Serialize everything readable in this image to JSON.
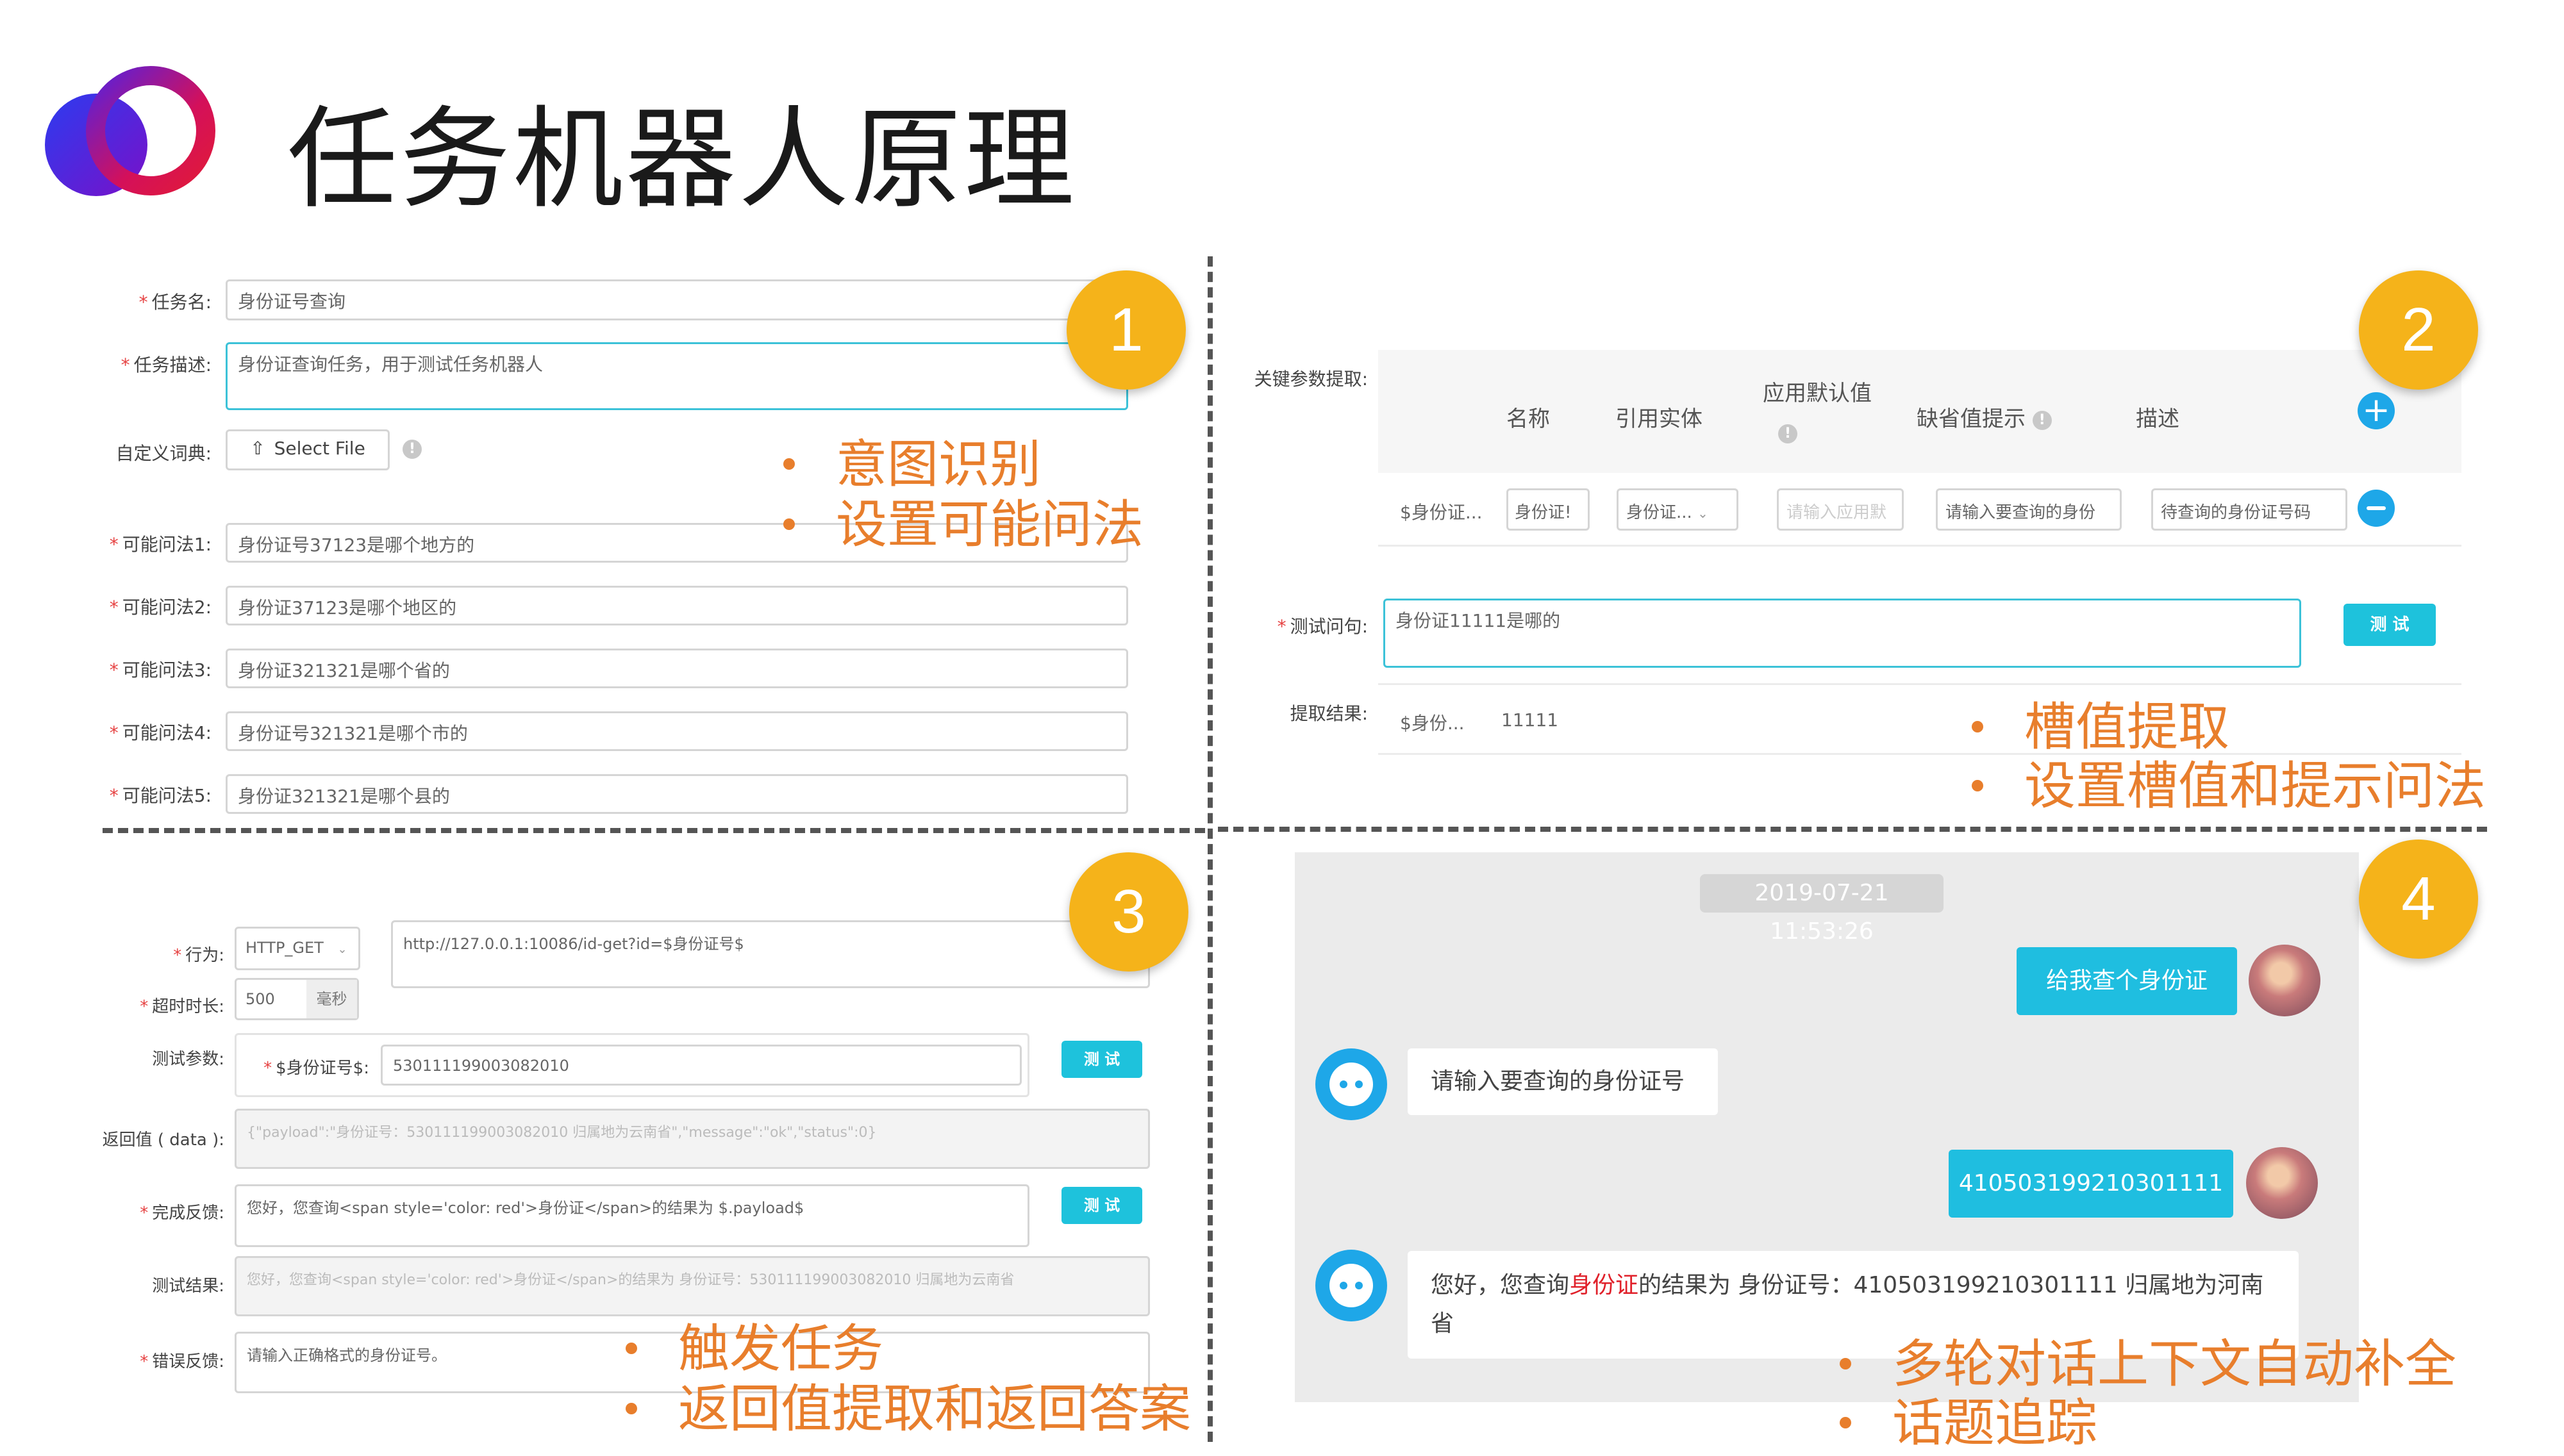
{
  "title": "任务机器人原理",
  "colors": {
    "accent": "#e87e2c",
    "badge": "#f5b31a",
    "button": "#1ec2dc",
    "chat_bubble": "#1fbee0"
  },
  "icons": {
    "logo": "overlapping-circles-logo",
    "upload": "upload-icon",
    "info": "info-icon",
    "add": "plus-circle-icon",
    "remove": "minus-circle-icon",
    "bot": "robot-avatar-icon",
    "user": "user-avatar-icon",
    "dropdown": "chevron-down-icon"
  },
  "panel1": {
    "badge": "1",
    "task_name_label": "任务名:",
    "task_name_value": "身份证号查询",
    "task_desc_label": "任务描述:",
    "task_desc_value": "身份证查询任务，用于测试任务机器人",
    "dict_label": "自定义词典:",
    "select_file": "Select File",
    "questions": [
      {
        "label": "可能问法1:",
        "value": "身份证号37123是哪个地方的"
      },
      {
        "label": "可能问法2:",
        "value": "身份证37123是哪个地区的"
      },
      {
        "label": "可能问法3:",
        "value": "身份证321321是哪个省的"
      },
      {
        "label": "可能问法4:",
        "value": "身份证号321321是哪个市的"
      },
      {
        "label": "可能问法5:",
        "value": "身份证321321是哪个县的"
      }
    ],
    "bullets": [
      "意图识别",
      "设置可能问法"
    ]
  },
  "panel2": {
    "badge": "2",
    "param_label": "关键参数提取:",
    "headers": {
      "name": "名称",
      "entity": "引用实体",
      "default": "应用默认值",
      "missing": "缺省值提示",
      "desc": "描述"
    },
    "row": {
      "name": "$身份证...",
      "entity_input": "身份证!",
      "entity_select": "身份证...",
      "default_placeholder": "请输入应用默",
      "missing": "请输入要查询的身份",
      "desc": "待查询的身份证号码"
    },
    "test_label": "测试问句:",
    "test_value": "身份证11111是哪的",
    "test_button": "测 试",
    "result_label": "提取结果:",
    "result_name": "$身份...",
    "result_value": "11111",
    "bullets": [
      "槽值提取",
      "设置槽值和提示问法"
    ]
  },
  "panel3": {
    "badge": "3",
    "action_label": "行为:",
    "action_value": "HTTP_GET",
    "url": "http://127.0.0.1:10086/id-get?id=$身份证号$",
    "timeout_label": "超时时长:",
    "timeout_value": "500",
    "timeout_unit": "毫秒",
    "test_param_label": "测试参数:",
    "param_name": "$身份证号$:",
    "param_value": "530111199003082010",
    "test_button": "测 试",
    "return_label": "返回值 ( data ):",
    "return_value": "{\"payload\":\"身份证号：530111199003082010 归属地为云南省\",\"message\":\"ok\",\"status\":0}",
    "done_label": "完成反馈:",
    "done_value": "您好，您查询<span style='color: red'>身份证</span>的结果为 $.payload$",
    "test_result_label": "测试结果:",
    "test_result_value": "您好，您查询<span style='color: red'>身份证</span>的结果为 身份证号：530111199003082010 归属地为云南省",
    "error_label": "错误反馈:",
    "error_value": "请输入正确格式的身份证号。",
    "bullets": [
      "触发任务",
      "返回值提取和返回答案"
    ]
  },
  "panel4": {
    "badge": "4",
    "timestamp": "2019-07-21 11:53:26",
    "msg_user_1": "给我查个身份证",
    "msg_bot_1": "请输入要查询的身份证号",
    "msg_user_2": "410503199210301111",
    "msg_bot_2_a": "您好，您查询",
    "msg_bot_2_red": "身份证",
    "msg_bot_2_b": "的结果为 身份证号：410503199210301111 归属地为河南省",
    "bullets": [
      "多轮对话上下文自动补全",
      "话题追踪"
    ]
  }
}
